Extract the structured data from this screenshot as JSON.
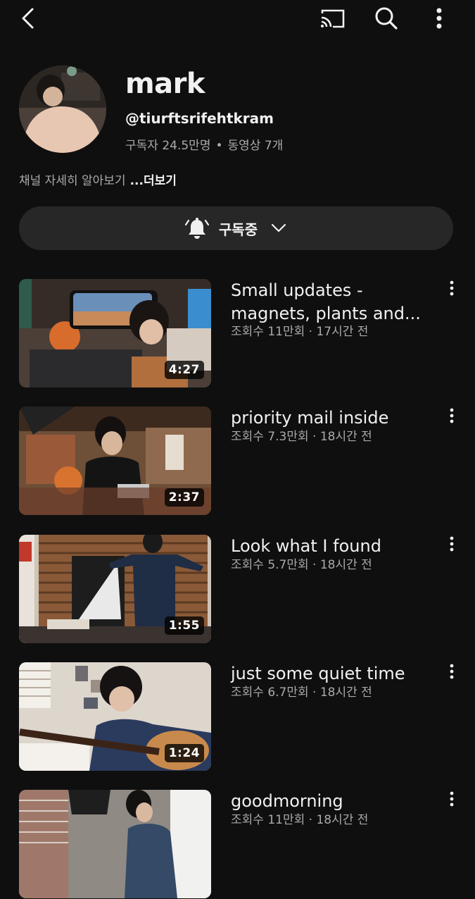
{
  "topbar": {
    "icons": [
      "back-arrow-icon",
      "cast-icon",
      "search-icon",
      "more-vert-icon"
    ]
  },
  "channel": {
    "name": "mark",
    "handle": "@tiurftsrifehtkram",
    "subscribers": "구독자 24.5만명",
    "separator": "•",
    "video_count": "동영상 7개",
    "about": "채널 자세히 알아보기",
    "more_link": "...더보기"
  },
  "subscribe": {
    "label": "구독중",
    "icon": "bell-icon"
  },
  "videos": [
    {
      "title": "Small updates - magnets, plants and...",
      "meta": "조회수 11만회 · 17시간 전",
      "duration": "4:27"
    },
    {
      "title": "priority mail inside",
      "meta": "조회수 7.3만회 · 18시간 전",
      "duration": "2:37"
    },
    {
      "title": "Look what I found",
      "meta": "조회수 5.7만회 · 18시간 전",
      "duration": "1:55"
    },
    {
      "title": "just some quiet time",
      "meta": "조회수 6.7만회 · 18시간 전",
      "duration": "1:24"
    },
    {
      "title": "goodmorning",
      "meta": "조회수 11만회 · 18시간 전",
      "duration": ""
    }
  ],
  "colors": {
    "background": "#0f0f0f",
    "text": "#f1f1f1",
    "secondary": "#aaaaaa",
    "button": "#272727"
  }
}
